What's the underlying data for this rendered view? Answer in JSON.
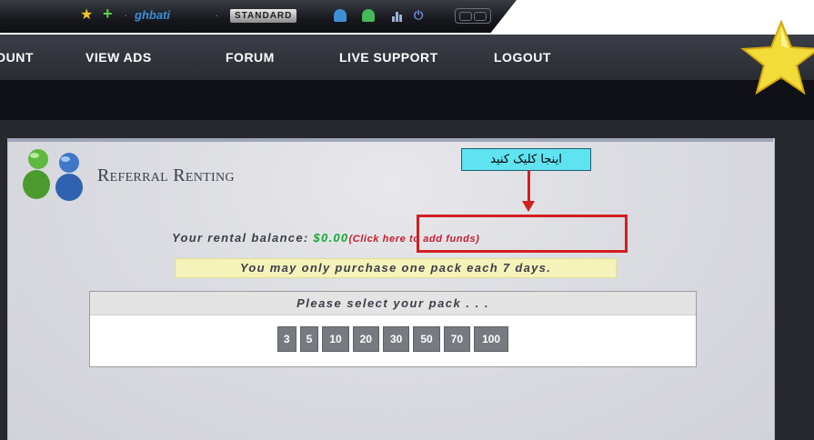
{
  "topbar": {
    "username": "ghbati",
    "separator": "·",
    "membership": "STANDARD"
  },
  "nav": {
    "items": [
      {
        "label": "DUNT"
      },
      {
        "label": "VIEW ADS"
      },
      {
        "label": "FORUM"
      },
      {
        "label": "LIVE SUPPORT"
      },
      {
        "label": "LOGOUT"
      }
    ]
  },
  "page": {
    "title": "Referral Renting",
    "annotation": "اینجا کلیک کنید",
    "balance_label": "Your rental balance:",
    "balance_value": "$0.00",
    "add_funds": "(Click here to add funds)",
    "notice": "You may only purchase one pack each 7 days.",
    "pack_header": "Please select your pack . . .",
    "packs": [
      "3",
      "5",
      "10",
      "20",
      "30",
      "50",
      "70",
      "100"
    ]
  },
  "colors": {
    "nav_bg": "#3b3e47",
    "balance_green": "#18a835",
    "link_red": "#c71c2d",
    "annotation_cyan": "#5fe3f1",
    "highlight_red": "#d21f1f",
    "notice_yellow": "#f6f3ba",
    "pack_button": "#777a80"
  },
  "icons": [
    "star-icon",
    "plus-icon",
    "users-icon",
    "user-icon",
    "stats-icon",
    "power-icon",
    "on-off-toggle-icon",
    "star-mascot-icon",
    "referral-logo-icon"
  ]
}
